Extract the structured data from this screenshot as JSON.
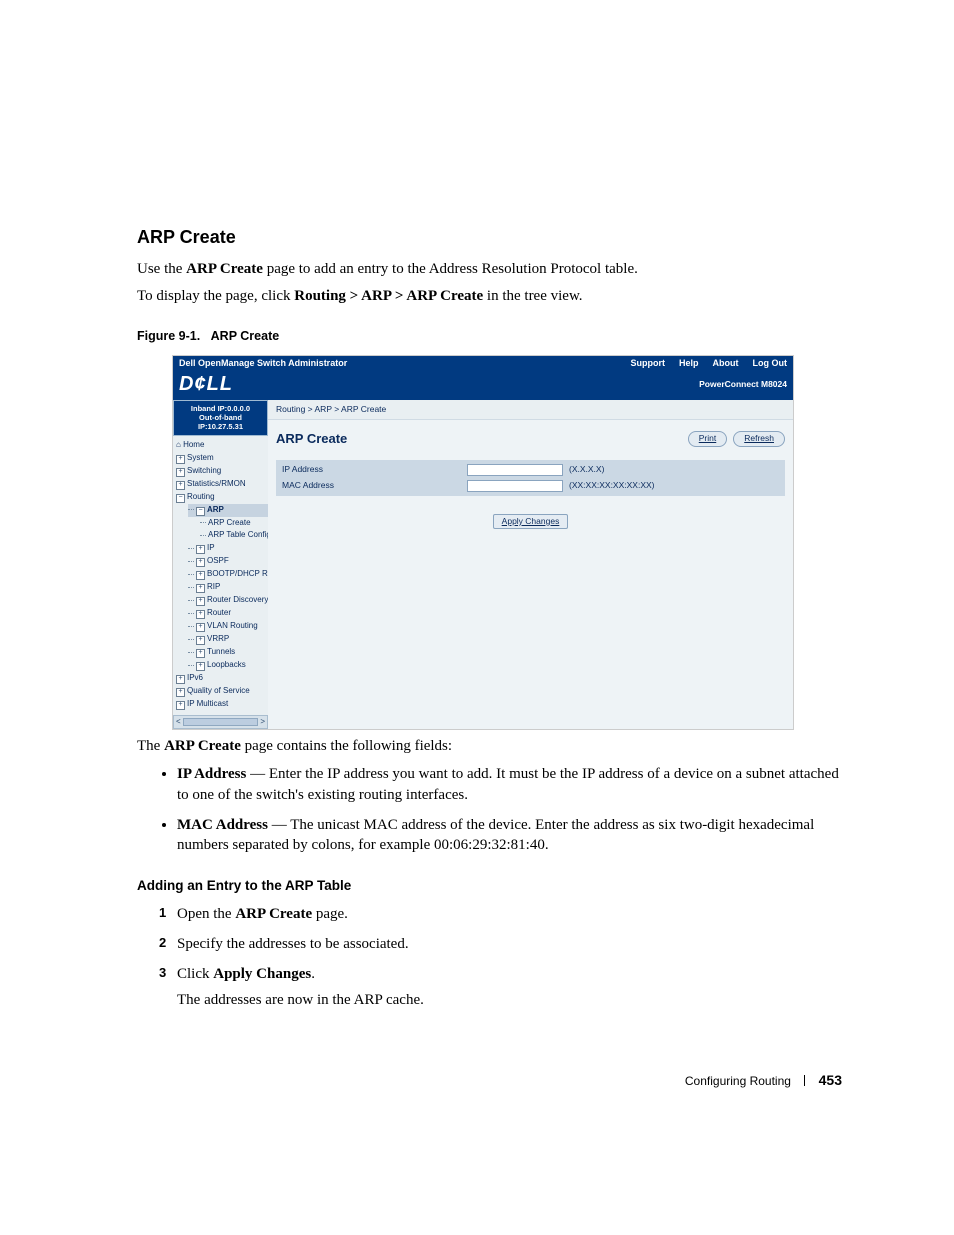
{
  "section": {
    "title": "ARP Create"
  },
  "para": {
    "intro_pre": "Use the ",
    "intro_bold": "ARP Create",
    "intro_post": " page to add an entry to the Address Resolution Protocol table.",
    "nav_pre": "To display the page, click ",
    "nav_bold": "Routing > ARP > ARP Create",
    "nav_post": " in the tree view."
  },
  "figcap": {
    "num": "Figure 9-1.",
    "title": "ARP Create"
  },
  "shot": {
    "topbar": {
      "left": "Dell OpenManage Switch Administrator",
      "links": [
        "Support",
        "Help",
        "About",
        "Log Out"
      ]
    },
    "brand": {
      "logo": "D¢LL",
      "product": "PowerConnect M8024"
    },
    "sidebar": {
      "ip1": "Inband IP:0.0.0.0",
      "ip2": "Out-of-band IP:10.27.5.31",
      "home": "Home",
      "top": [
        {
          "sym": "+",
          "label": "System"
        },
        {
          "sym": "+",
          "label": "Switching"
        },
        {
          "sym": "+",
          "label": "Statistics/RMON"
        },
        {
          "sym": "−",
          "label": "Routing"
        }
      ],
      "arp": {
        "sym": "−",
        "label": "ARP",
        "children": [
          "ARP Create",
          "ARP Table Configu"
        ]
      },
      "mid": [
        {
          "sym": "+",
          "label": "IP"
        },
        {
          "sym": "+",
          "label": "OSPF"
        },
        {
          "sym": "+",
          "label": "BOOTP/DHCP Relay "
        },
        {
          "sym": "+",
          "label": "RIP"
        },
        {
          "sym": "+",
          "label": "Router Discovery"
        },
        {
          "sym": "+",
          "label": "Router"
        },
        {
          "sym": "+",
          "label": "VLAN Routing"
        },
        {
          "sym": "+",
          "label": "VRRP"
        },
        {
          "sym": "+",
          "label": "Tunnels"
        },
        {
          "sym": "+",
          "label": "Loopbacks"
        }
      ],
      "bottom": [
        {
          "sym": "+",
          "label": "IPv6"
        },
        {
          "sym": "+",
          "label": "Quality of Service"
        },
        {
          "sym": "+",
          "label": "IP Multicast"
        }
      ],
      "scroll": {
        "left": "<",
        "right": ">"
      }
    },
    "main": {
      "breadcrumb": "Routing > ARP > ARP Create",
      "title": "ARP Create",
      "btn_print": "Print",
      "btn_refresh": "Refresh",
      "rows": [
        {
          "label": "IP Address",
          "value": "",
          "hint": "(X.X.X.X)"
        },
        {
          "label": "MAC Address",
          "value": "",
          "hint": "(XX:XX:XX:XX:XX:XX)"
        }
      ],
      "apply": "Apply Changes"
    }
  },
  "after": {
    "lead_pre": "The ",
    "lead_bold": "ARP Create",
    "lead_post": " page contains the following fields:"
  },
  "fields": {
    "ip": {
      "name": "IP Address",
      "dash": " — ",
      "desc": "Enter the IP address you want to add. It must be the IP address of a device on a subnet attached to one of the switch's existing routing interfaces."
    },
    "mac": {
      "name": "MAC Address",
      "dash": " — ",
      "desc": "The unicast MAC address of the device. Enter the address as six two-digit hexadecimal numbers separated by colons, for example 00:06:29:32:81:40."
    }
  },
  "subhead": "Adding an Entry to the ARP Table",
  "steps": {
    "s1_pre": "Open the ",
    "s1_bold": "ARP Create",
    "s1_post": " page.",
    "s2": "Specify the addresses to be associated.",
    "s3_pre": "Click ",
    "s3_bold": "Apply Changes",
    "s3_post": ".",
    "s3_after": "The addresses are now in the ARP cache."
  },
  "footer": {
    "chapter": "Configuring Routing",
    "page": "453"
  }
}
